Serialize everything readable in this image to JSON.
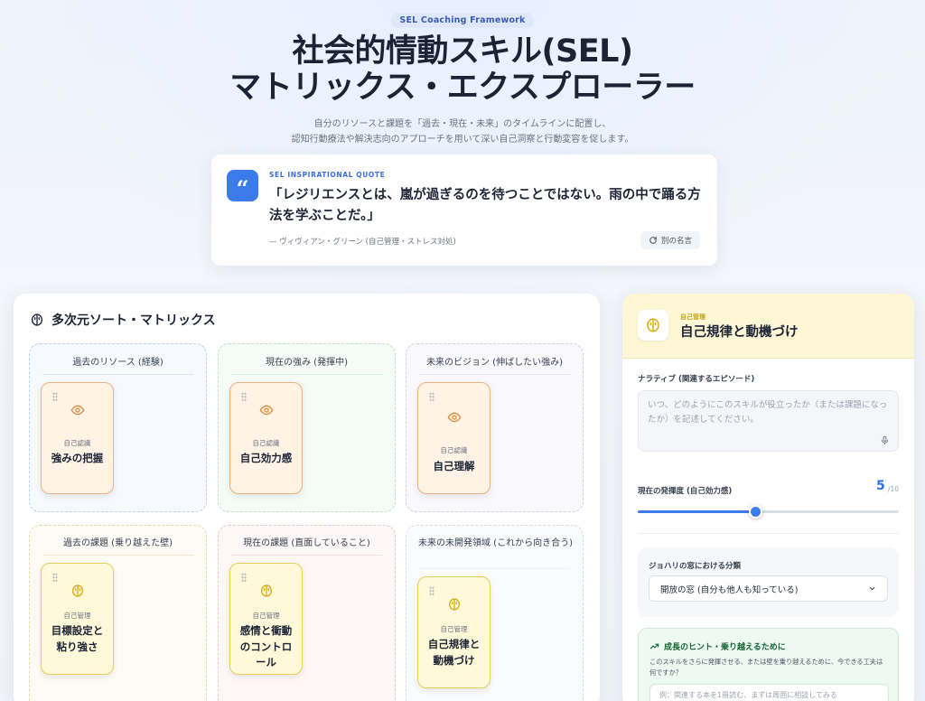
{
  "header": {
    "badge": "SEL Coaching Framework",
    "title_line1": "社会的情動スキル(SEL)",
    "title_line2": "マトリックス・エクスプローラー",
    "subtitle_line1": "自分のリソースと課題を「過去・現在・未来」のタイムラインに配置し、",
    "subtitle_line2": "認知行動療法や解決志向のアプローチを用いて深い自己洞察と行動変容を促します。"
  },
  "quote": {
    "label": "SEL INSPIRATIONAL QUOTE",
    "text": "「レジリエンスとは、嵐が過ぎるのを待つことではない。雨の中で踊る方法を学ぶことだ。」",
    "author": "— ヴィヴィアン・グリーン (自己管理・ストレス対処)",
    "next_button": "別の名言",
    "icon": "quote-icon"
  },
  "matrix": {
    "title": "多次元ソート・マトリックス",
    "zones": [
      {
        "title": "過去のリソース (経験)",
        "cards": [
          {
            "category": "自己認識",
            "name": "強みの把握",
            "icon": "eye-icon"
          }
        ]
      },
      {
        "title": "現在の強み (発揮中)",
        "cards": [
          {
            "category": "自己認識",
            "name": "自己効力感",
            "icon": "eye-icon"
          }
        ]
      },
      {
        "title": "未来のビジョン (伸ばしたい強み)",
        "cards": [
          {
            "category": "自己認識",
            "name": "自己理解",
            "icon": "eye-icon"
          }
        ]
      },
      {
        "title": "過去の課題 (乗り越えた壁)",
        "cards": [
          {
            "category": "自己管理",
            "name": "目標設定と粘り強さ",
            "icon": "brain-icon"
          }
        ]
      },
      {
        "title": "現在の課題 (直面していること)",
        "cards": [
          {
            "category": "自己管理",
            "name": "感情と衝動のコントロール",
            "icon": "brain-icon"
          }
        ]
      },
      {
        "title": "未来の未開発領域 (これから向き合う)",
        "cards": [
          {
            "category": "自己管理",
            "name": "自己規律と動機づけ",
            "icon": "brain-icon"
          }
        ]
      }
    ]
  },
  "detail": {
    "category": "自己管理",
    "name": "自己規律と動機づけ",
    "narrative_label": "ナラティブ (関連するエピソード)",
    "narrative_placeholder": "いつ、どのようにこのスキルが役立ったか（または課題になったか）を記述してください。",
    "progress_label": "現在の発揮度 (自己効力感)",
    "progress_value": "5",
    "progress_max": "/10",
    "progress_fraction": 0.45,
    "johari_label": "ジョハリの窓における分類",
    "johari_selected": "開放の窓 (自分も他人も知っている)",
    "hint_title": "成長のヒント・乗り越えるために",
    "hint_text": "このスキルをさらに発揮させる、または壁を乗り越えるために、今できる工夫は何ですか？",
    "hint_placeholder": "例：関連する本を1冊読む、まずは周囲に相談してみる"
  },
  "colors": {
    "accent": "#3b7bea",
    "orange_card": "#fff3e6",
    "yellow_card": "#fff9d9",
    "eye_icon": "#e08a3c",
    "brain_icon": "#d9a912"
  }
}
